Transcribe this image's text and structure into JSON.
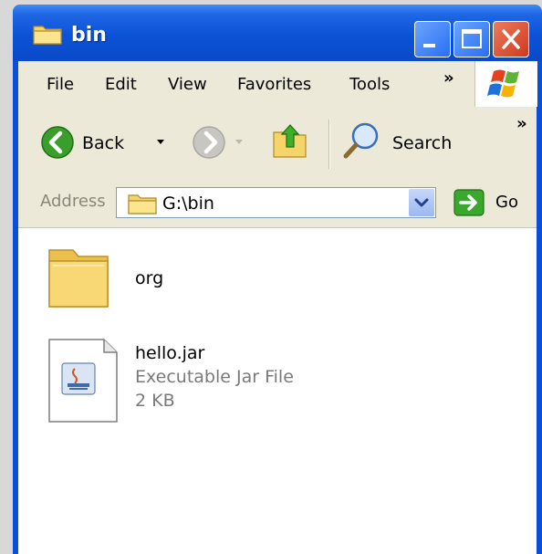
{
  "window": {
    "title": "bin"
  },
  "menu": {
    "items": [
      "File",
      "Edit",
      "View",
      "Favorites",
      "Tools"
    ],
    "overflow": "»"
  },
  "toolbar": {
    "back_label": "Back",
    "search_label": "Search",
    "overflow": "»"
  },
  "address": {
    "label": "Address",
    "path": "G:\\bin",
    "go_label": "Go"
  },
  "files": [
    {
      "name": "org",
      "type": "",
      "size": ""
    },
    {
      "name": "hello.jar",
      "type": "Executable Jar File",
      "size": "2 KB"
    }
  ],
  "colors": {
    "titlebar": "#0a4fd8",
    "close": "#d9472a",
    "chrome": "#ece9d8",
    "folder": "#f5d46a"
  },
  "icons": [
    "folder-icon",
    "minimize-icon",
    "maximize-icon",
    "close-icon",
    "windows-logo-icon",
    "back-arrow-icon",
    "forward-arrow-icon",
    "up-folder-icon",
    "search-icon",
    "address-folder-icon",
    "go-icon",
    "jar-file-icon"
  ]
}
